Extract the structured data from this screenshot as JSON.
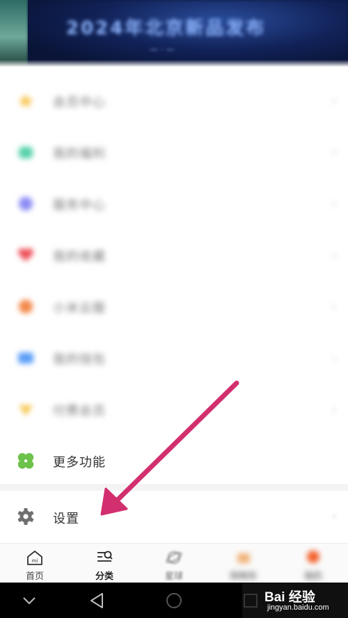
{
  "colors": {
    "arrow": "#d22f6e",
    "clover": "#6cc24a",
    "gear": "#6f6f6f"
  },
  "menu": {
    "items": [
      {
        "label": "会员中心",
        "icon": "star-icon",
        "color": "#f7c24b"
      },
      {
        "label": "我的福利",
        "icon": "gift-icon",
        "color": "#56d1aa"
      },
      {
        "label": "服务中心",
        "icon": "service-icon",
        "color": "#8c8cf5"
      },
      {
        "label": "我的收藏",
        "icon": "heart-icon",
        "color": "#ee4d57"
      },
      {
        "label": "小米云服",
        "icon": "cloud-icon",
        "color": "#f3894a"
      },
      {
        "label": "我的钱包",
        "icon": "wallet-icon",
        "color": "#5b9ef6"
      },
      {
        "label": "付费会员",
        "icon": "crown-icon",
        "color": "#f6c54a"
      },
      {
        "label": "更多功能",
        "icon": "clover-icon",
        "color": "#6cc24a"
      }
    ],
    "chevron": "›"
  },
  "settings": {
    "label": "设置",
    "icon": "gear-icon"
  },
  "banner": {
    "title": "2024年北京新品发布",
    "sub": "— · —"
  },
  "tabs": [
    {
      "label": "首页",
      "icon": "mi-home-icon"
    },
    {
      "label": "分类",
      "icon": "category-search-icon"
    },
    {
      "label": "星球",
      "icon": "planet-icon"
    },
    {
      "label": "购物车",
      "icon": "cart-icon"
    },
    {
      "label": "我的",
      "icon": "profile-icon"
    }
  ],
  "watermark": {
    "logo": "Bai  经验",
    "url": "jingyan.baidu.com"
  }
}
